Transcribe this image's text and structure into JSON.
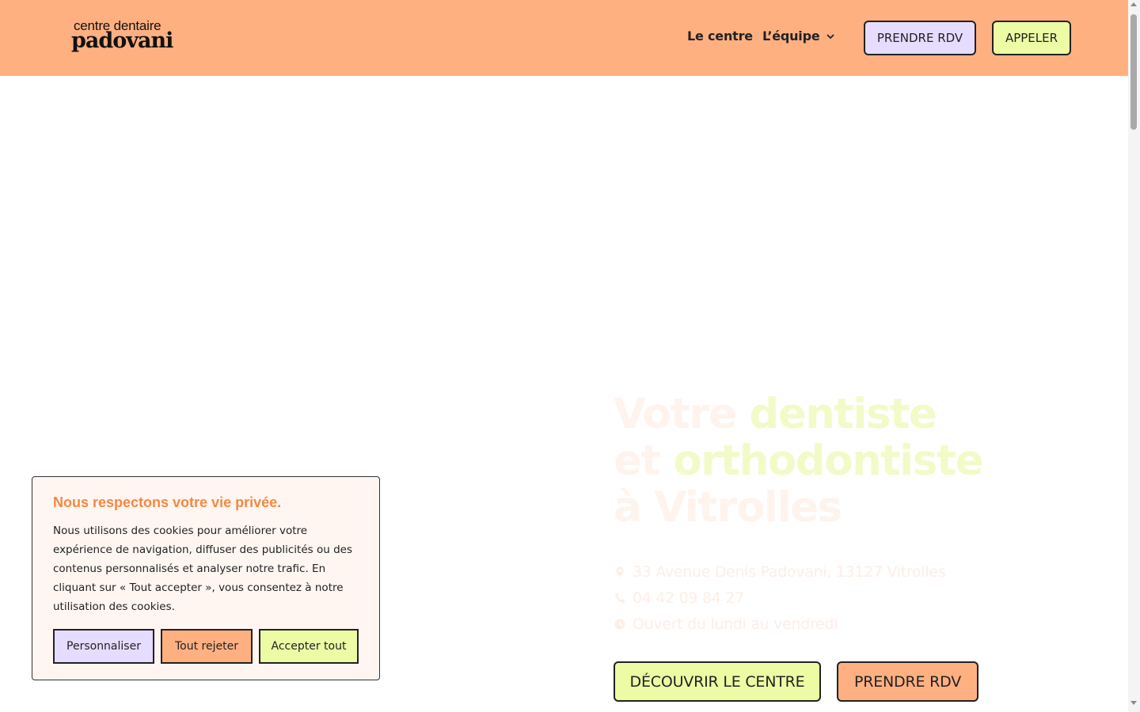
{
  "header": {
    "logo_top": "centre dentaire",
    "logo_main": "padovani",
    "nav": {
      "centre": "Le centre",
      "equipe": "L’équipe"
    },
    "btn_rdv": "PRENDRE RDV",
    "btn_call": "APPELER"
  },
  "hero": {
    "title_l1_a": "Votre ",
    "title_l1_b": "dentiste",
    "title_l2_a": "et ",
    "title_l2_b": "orthodontiste",
    "title_l3": "à Vitrolles",
    "address": "33 Avenue Denis Padovani, 13127 Vitrolles",
    "phone": "04 42 09 84 27",
    "hours": "Ouvert du lundi au vendredi",
    "cta_discover": "DÉCOUVRIR LE CENTRE",
    "cta_rdv": "PRENDRE RDV"
  },
  "cookie": {
    "title": "Nous respectons votre vie privée.",
    "text": "Nous utilisons des cookies pour améliorer votre expérience de navigation, diffuser des publicités ou des contenus personnalisés et analyser notre trafic. En cliquant sur « Tout accepter », vous consentez à notre utilisation des cookies.",
    "btn_customize": "Personnaliser",
    "btn_reject": "Tout rejeter",
    "btn_accept": "Accepter tout"
  },
  "colors": {
    "header_bg": "#ffb081",
    "lavender": "#e5dcff",
    "lime": "#ecfba4",
    "cookie_title": "#f58840"
  },
  "icons": [
    "chevron-down-icon",
    "map-pin-icon",
    "phone-icon",
    "clock-icon"
  ]
}
